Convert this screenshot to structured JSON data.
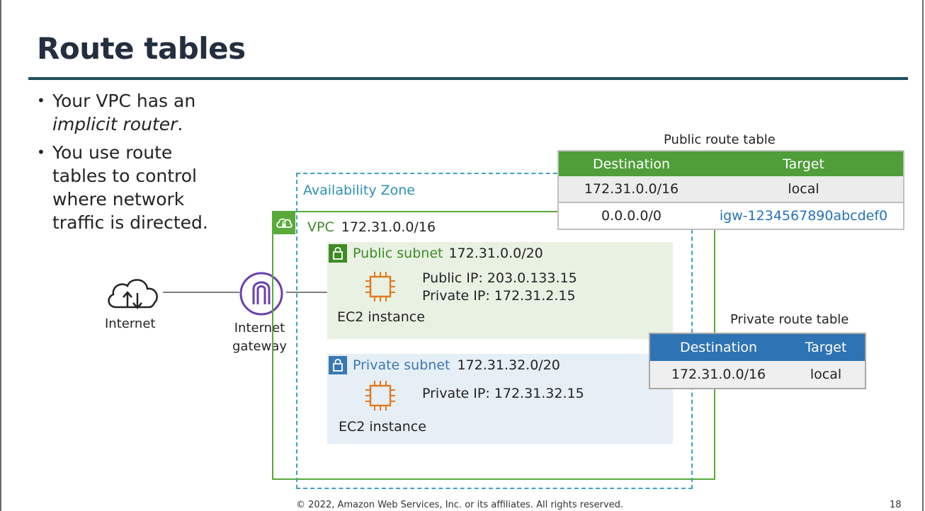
{
  "slide": {
    "title": "Route tables",
    "bullets": [
      {
        "text_before": "Your VPC has an ",
        "emphasis": "implicit router",
        "text_after": "."
      },
      {
        "text": "You use route tables to control where network traffic is directed."
      }
    ],
    "footer": "© 2022, Amazon Web Services, Inc. or its affiliates. All rights reserved.",
    "page_number": "18"
  },
  "diagram": {
    "internet_label": "Internet",
    "gateway_label_line1": "Internet",
    "gateway_label_line2": "gateway",
    "availability_zone_label": "Availability Zone",
    "vpc": {
      "label": "VPC",
      "cidr": "172.31.0.0/16"
    },
    "public_subnet": {
      "label": "Public subnet",
      "cidr": "172.31.0.0/20",
      "public_ip": "Public IP:  203.0.133.15",
      "private_ip": "Private IP: 172.31.2.15",
      "instance_label": "EC2 instance"
    },
    "private_subnet": {
      "label": "Private subnet",
      "cidr": "172.31.32.0/20",
      "private_ip": "Private IP: 172.31.32.15",
      "instance_label": "EC2 instance"
    },
    "public_route_table": {
      "caption": "Public route table",
      "headers": [
        "Destination",
        "Target"
      ],
      "rows": [
        [
          "172.31.0.0/16",
          "local"
        ],
        [
          "0.0.0.0/0",
          "igw-1234567890abcdef0"
        ]
      ]
    },
    "private_route_table": {
      "caption": "Private route table",
      "headers": [
        "Destination",
        "Target"
      ],
      "rows": [
        [
          "172.31.0.0/16",
          "local"
        ]
      ]
    },
    "colors": {
      "vpc_green": "#5aaa3a",
      "public_green": "#3d8b25",
      "private_blue": "#3a78b4",
      "az_dashed": "#3fa2c4",
      "gateway_purple": "#6b3fb0",
      "ec2_orange": "#e07b21",
      "igw_link": "#2572b8"
    },
    "icons": [
      "cloud-upload-download-icon",
      "internet-gateway-icon",
      "lock-icon",
      "cloud-icon",
      "ec2-chip-icon"
    ]
  }
}
